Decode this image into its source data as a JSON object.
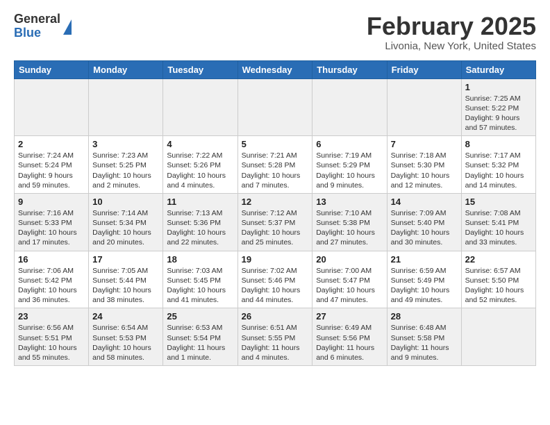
{
  "header": {
    "logo_general": "General",
    "logo_blue": "Blue",
    "month_year": "February 2025",
    "location": "Livonia, New York, United States"
  },
  "days_of_week": [
    "Sunday",
    "Monday",
    "Tuesday",
    "Wednesday",
    "Thursday",
    "Friday",
    "Saturday"
  ],
  "weeks": [
    [
      {
        "day": "",
        "info": ""
      },
      {
        "day": "",
        "info": ""
      },
      {
        "day": "",
        "info": ""
      },
      {
        "day": "",
        "info": ""
      },
      {
        "day": "",
        "info": ""
      },
      {
        "day": "",
        "info": ""
      },
      {
        "day": "1",
        "info": "Sunrise: 7:25 AM\nSunset: 5:22 PM\nDaylight: 9 hours and 57 minutes."
      }
    ],
    [
      {
        "day": "2",
        "info": "Sunrise: 7:24 AM\nSunset: 5:24 PM\nDaylight: 9 hours and 59 minutes."
      },
      {
        "day": "3",
        "info": "Sunrise: 7:23 AM\nSunset: 5:25 PM\nDaylight: 10 hours and 2 minutes."
      },
      {
        "day": "4",
        "info": "Sunrise: 7:22 AM\nSunset: 5:26 PM\nDaylight: 10 hours and 4 minutes."
      },
      {
        "day": "5",
        "info": "Sunrise: 7:21 AM\nSunset: 5:28 PM\nDaylight: 10 hours and 7 minutes."
      },
      {
        "day": "6",
        "info": "Sunrise: 7:19 AM\nSunset: 5:29 PM\nDaylight: 10 hours and 9 minutes."
      },
      {
        "day": "7",
        "info": "Sunrise: 7:18 AM\nSunset: 5:30 PM\nDaylight: 10 hours and 12 minutes."
      },
      {
        "day": "8",
        "info": "Sunrise: 7:17 AM\nSunset: 5:32 PM\nDaylight: 10 hours and 14 minutes."
      }
    ],
    [
      {
        "day": "9",
        "info": "Sunrise: 7:16 AM\nSunset: 5:33 PM\nDaylight: 10 hours and 17 minutes."
      },
      {
        "day": "10",
        "info": "Sunrise: 7:14 AM\nSunset: 5:34 PM\nDaylight: 10 hours and 20 minutes."
      },
      {
        "day": "11",
        "info": "Sunrise: 7:13 AM\nSunset: 5:36 PM\nDaylight: 10 hours and 22 minutes."
      },
      {
        "day": "12",
        "info": "Sunrise: 7:12 AM\nSunset: 5:37 PM\nDaylight: 10 hours and 25 minutes."
      },
      {
        "day": "13",
        "info": "Sunrise: 7:10 AM\nSunset: 5:38 PM\nDaylight: 10 hours and 27 minutes."
      },
      {
        "day": "14",
        "info": "Sunrise: 7:09 AM\nSunset: 5:40 PM\nDaylight: 10 hours and 30 minutes."
      },
      {
        "day": "15",
        "info": "Sunrise: 7:08 AM\nSunset: 5:41 PM\nDaylight: 10 hours and 33 minutes."
      }
    ],
    [
      {
        "day": "16",
        "info": "Sunrise: 7:06 AM\nSunset: 5:42 PM\nDaylight: 10 hours and 36 minutes."
      },
      {
        "day": "17",
        "info": "Sunrise: 7:05 AM\nSunset: 5:44 PM\nDaylight: 10 hours and 38 minutes."
      },
      {
        "day": "18",
        "info": "Sunrise: 7:03 AM\nSunset: 5:45 PM\nDaylight: 10 hours and 41 minutes."
      },
      {
        "day": "19",
        "info": "Sunrise: 7:02 AM\nSunset: 5:46 PM\nDaylight: 10 hours and 44 minutes."
      },
      {
        "day": "20",
        "info": "Sunrise: 7:00 AM\nSunset: 5:47 PM\nDaylight: 10 hours and 47 minutes."
      },
      {
        "day": "21",
        "info": "Sunrise: 6:59 AM\nSunset: 5:49 PM\nDaylight: 10 hours and 49 minutes."
      },
      {
        "day": "22",
        "info": "Sunrise: 6:57 AM\nSunset: 5:50 PM\nDaylight: 10 hours and 52 minutes."
      }
    ],
    [
      {
        "day": "23",
        "info": "Sunrise: 6:56 AM\nSunset: 5:51 PM\nDaylight: 10 hours and 55 minutes."
      },
      {
        "day": "24",
        "info": "Sunrise: 6:54 AM\nSunset: 5:53 PM\nDaylight: 10 hours and 58 minutes."
      },
      {
        "day": "25",
        "info": "Sunrise: 6:53 AM\nSunset: 5:54 PM\nDaylight: 11 hours and 1 minute."
      },
      {
        "day": "26",
        "info": "Sunrise: 6:51 AM\nSunset: 5:55 PM\nDaylight: 11 hours and 4 minutes."
      },
      {
        "day": "27",
        "info": "Sunrise: 6:49 AM\nSunset: 5:56 PM\nDaylight: 11 hours and 6 minutes."
      },
      {
        "day": "28",
        "info": "Sunrise: 6:48 AM\nSunset: 5:58 PM\nDaylight: 11 hours and 9 minutes."
      },
      {
        "day": "",
        "info": ""
      }
    ]
  ]
}
